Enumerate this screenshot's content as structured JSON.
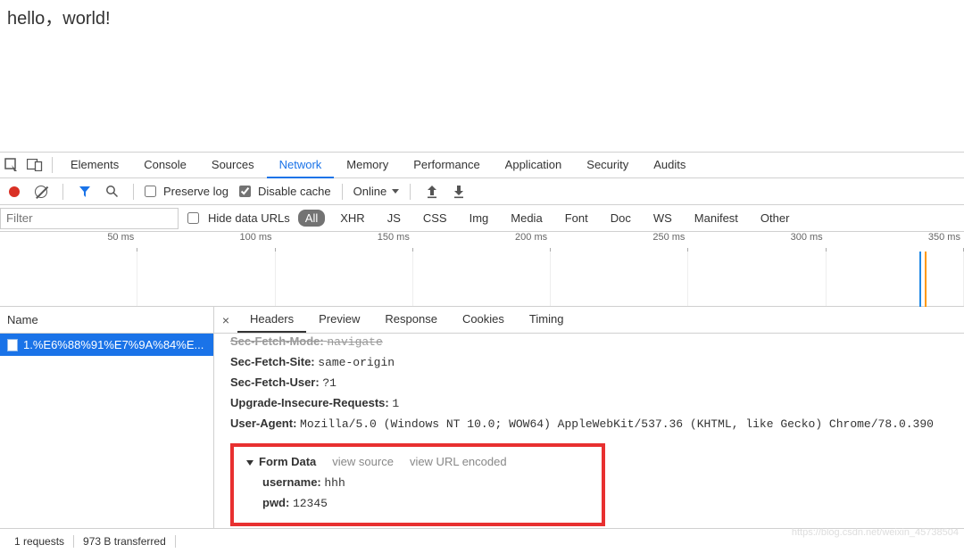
{
  "page": {
    "text": "hello，world!"
  },
  "tabs": {
    "items": [
      "Elements",
      "Console",
      "Sources",
      "Network",
      "Memory",
      "Performance",
      "Application",
      "Security",
      "Audits"
    ],
    "active": "Network"
  },
  "toolbar": {
    "preserve_log": "Preserve log",
    "disable_cache": "Disable cache",
    "online": "Online"
  },
  "filter": {
    "placeholder": "Filter",
    "hide_data_urls": "Hide data URLs",
    "types": [
      "All",
      "XHR",
      "JS",
      "CSS",
      "Img",
      "Media",
      "Font",
      "Doc",
      "WS",
      "Manifest",
      "Other"
    ],
    "active_type": "All"
  },
  "timeline": {
    "ticks": [
      "50 ms",
      "100 ms",
      "150 ms",
      "200 ms",
      "250 ms",
      "300 ms",
      "350 ms"
    ]
  },
  "requests_header": "Name",
  "requests": [
    {
      "label": "1.%E6%88%91%E7%9A%84%E..."
    }
  ],
  "detail_tabs": {
    "items": [
      "Headers",
      "Preview",
      "Response",
      "Cookies",
      "Timing"
    ],
    "active": "Headers"
  },
  "response_headers": [
    {
      "k": "Sec-Fetch-Mode:",
      "v": "navigate"
    },
    {
      "k": "Sec-Fetch-Site:",
      "v": "same-origin"
    },
    {
      "k": "Sec-Fetch-User:",
      "v": "?1"
    },
    {
      "k": "Upgrade-Insecure-Requests:",
      "v": "1"
    },
    {
      "k": "User-Agent:",
      "v": "Mozilla/5.0 (Windows NT 10.0; WOW64) AppleWebKit/537.36 (KHTML, like Gecko) Chrome/78.0.390"
    }
  ],
  "form_data": {
    "title": "Form Data",
    "view_source": "view source",
    "view_url_encoded": "view URL encoded",
    "rows": [
      {
        "k": "username:",
        "v": "hhh"
      },
      {
        "k": "pwd:",
        "v": "12345"
      }
    ]
  },
  "statusbar": {
    "requests": "1 requests",
    "transferred": "973 B transferred"
  },
  "watermark": "https://blog.csdn.net/weixin_45738504"
}
